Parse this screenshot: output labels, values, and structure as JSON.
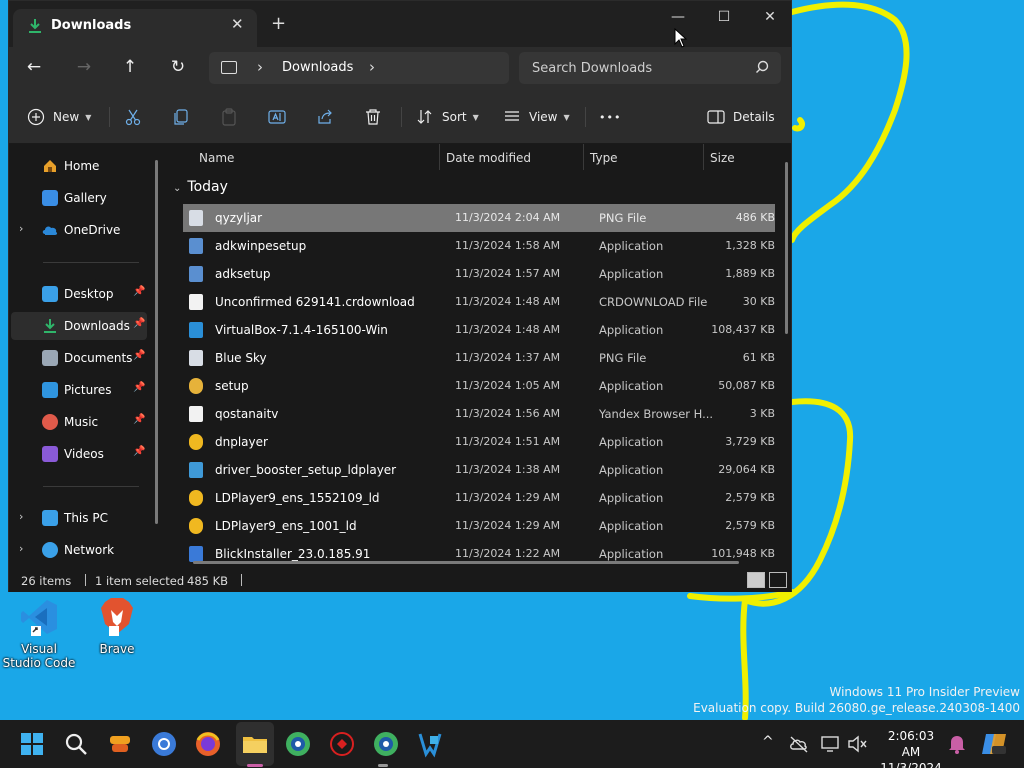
{
  "window": {
    "tab_title": "Downloads",
    "tab_close": "✕",
    "new_tab": "+",
    "minimize": "—",
    "maximize": "☐",
    "close": "✕"
  },
  "navigation": {
    "back": "←",
    "forward": "→",
    "up": "↑",
    "refresh": "↻",
    "breadcrumb_sep": "›",
    "breadcrumb": "Downloads",
    "search_placeholder": "Search Downloads"
  },
  "commands": {
    "new": "New",
    "sort": "Sort",
    "view": "View",
    "more": "•••",
    "details": "Details"
  },
  "sidebar": {
    "items": [
      {
        "label": "Home",
        "icon": "home-icon",
        "color": "#e8a02a"
      },
      {
        "label": "Gallery",
        "icon": "gallery-icon",
        "color": "#3a8ee6"
      },
      {
        "label": "OneDrive",
        "icon": "onedrive-icon",
        "color": "#2b88d8"
      },
      {
        "label": "Desktop",
        "icon": "desktop-icon",
        "color": "#3aa0e8"
      },
      {
        "label": "Downloads",
        "icon": "downloads-icon",
        "color": "#2fb56a"
      },
      {
        "label": "Documents",
        "icon": "documents-icon",
        "color": "#9aa7b5"
      },
      {
        "label": "Pictures",
        "icon": "pictures-icon",
        "color": "#2f95e0"
      },
      {
        "label": "Music",
        "icon": "music-icon",
        "color": "#e05a4a"
      },
      {
        "label": "Videos",
        "icon": "videos-icon",
        "color": "#8a5ad8"
      },
      {
        "label": "This PC",
        "icon": "this-pc-icon",
        "color": "#3aa0e8"
      },
      {
        "label": "Network",
        "icon": "network-icon",
        "color": "#3aa0e8"
      }
    ],
    "pin": "📌",
    "chevron": "›"
  },
  "columns": {
    "name": "Name",
    "date": "Date modified",
    "type": "Type",
    "size": "Size"
  },
  "group_label": "Today",
  "group_chevron": "⌄",
  "files": [
    {
      "name": "qyzyljar",
      "date": "11/3/2024 2:04 AM",
      "type": "PNG File",
      "size": "486 KB",
      "icon": "image-file-icon",
      "color": "#d8dde5"
    },
    {
      "name": "adkwinpesetup",
      "date": "11/3/2024 1:58 AM",
      "type": "Application",
      "size": "1,328 KB",
      "icon": "installer-icon",
      "color": "#5a8fd0"
    },
    {
      "name": "adksetup",
      "date": "11/3/2024 1:57 AM",
      "type": "Application",
      "size": "1,889 KB",
      "icon": "installer-icon",
      "color": "#5a8fd0"
    },
    {
      "name": "Unconfirmed 629141.crdownload",
      "date": "11/3/2024 1:48 AM",
      "type": "CRDOWNLOAD File",
      "size": "30 KB",
      "icon": "blank-file-icon",
      "color": "#f2f2f2"
    },
    {
      "name": "VirtualBox-7.1.4-165100-Win",
      "date": "11/3/2024 1:48 AM",
      "type": "Application",
      "size": "108,437 KB",
      "icon": "virtualbox-icon",
      "color": "#2a8fd8"
    },
    {
      "name": "Blue Sky",
      "date": "11/3/2024 1:37 AM",
      "type": "PNG File",
      "size": "61 KB",
      "icon": "image-file-icon",
      "color": "#d8dde5"
    },
    {
      "name": "setup",
      "date": "11/3/2024 1:05 AM",
      "type": "Application",
      "size": "50,087 KB",
      "icon": "chrome-setup-icon",
      "color": "#e6b23a"
    },
    {
      "name": "qostanaitv",
      "date": "11/3/2024 1:56 AM",
      "type": "Yandex Browser H...",
      "size": "3 KB",
      "icon": "blank-file-icon",
      "color": "#f2f2f2"
    },
    {
      "name": "dnplayer",
      "date": "11/3/2024 1:51 AM",
      "type": "Application",
      "size": "3,729 KB",
      "icon": "ldplayer-icon",
      "color": "#f0b820"
    },
    {
      "name": "driver_booster_setup_ldplayer",
      "date": "11/3/2024 1:38 AM",
      "type": "Application",
      "size": "29,064 KB",
      "icon": "driver-booster-icon",
      "color": "#3f9ad8"
    },
    {
      "name": "LDPlayer9_ens_1552109_ld",
      "date": "11/3/2024 1:29 AM",
      "type": "Application",
      "size": "2,579 KB",
      "icon": "ldplayer-icon",
      "color": "#f0b820"
    },
    {
      "name": "LDPlayer9_ens_1001_ld",
      "date": "11/3/2024 1:29 AM",
      "type": "Application",
      "size": "2,579 KB",
      "icon": "ldplayer-icon",
      "color": "#f0b820"
    },
    {
      "name": "BlickInstaller_23.0.185.91",
      "date": "11/3/2024 1:22 AM",
      "type": "Application",
      "size": "101,948 KB",
      "icon": "installer-icon",
      "color": "#3a7ad8"
    }
  ],
  "status": {
    "count": "26 items",
    "selected": "1 item selected",
    "size": "485 KB"
  },
  "desktop_icons": [
    {
      "label": "Visual Studio Code",
      "icon": "vscode-icon"
    },
    {
      "label": "Brave",
      "icon": "brave-icon"
    }
  ],
  "watermark": {
    "line1": "Windows 11 Pro Insider Preview",
    "line2": "Evaluation copy. Build 26080.ge_release.240308-1400"
  },
  "taskbar": {
    "icons": [
      "start-icon",
      "search-icon",
      "chat-icon",
      "chrome-icon",
      "firefox-icon",
      "file-explorer-icon",
      "browser-icon",
      "app-icon",
      "browser2-icon",
      "virtualbox-icon"
    ],
    "tray_chevron": "^",
    "time": "2:06:03 AM",
    "date": "11/3/2024"
  },
  "colors": {
    "accent": "#c95fa6",
    "desktop": "#1aa7e8",
    "doodle": "#f0f000"
  }
}
